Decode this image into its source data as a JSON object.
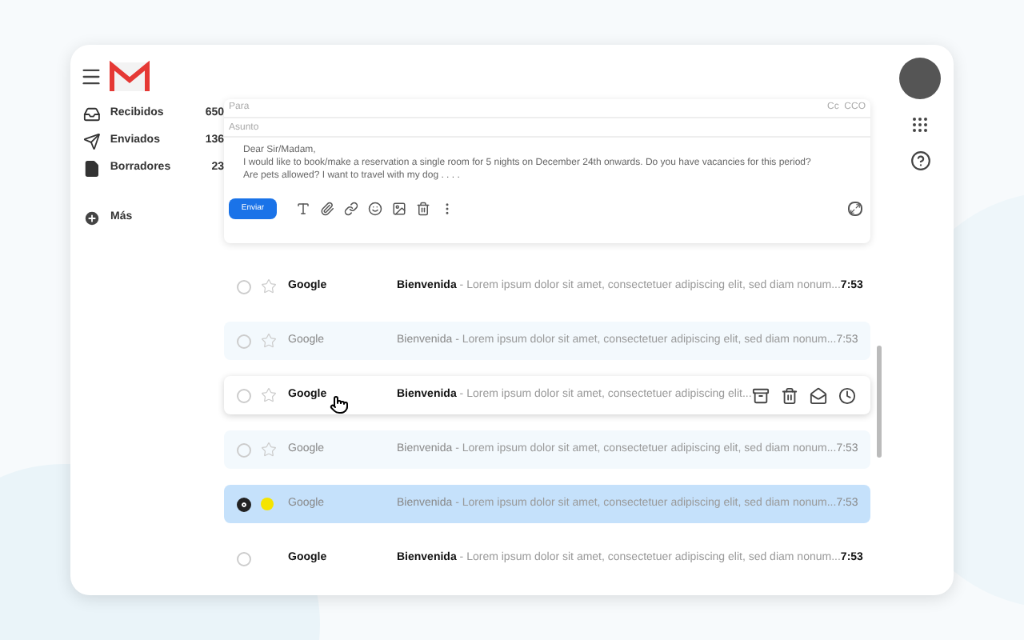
{
  "sidebar": {
    "items": [
      {
        "kind": "inbox",
        "label": "Recibidos",
        "count": "650"
      },
      {
        "kind": "sent",
        "label": "Enviados",
        "count": "136"
      },
      {
        "kind": "drafts",
        "label": "Borradores",
        "count": "23"
      }
    ],
    "more": "Más"
  },
  "compose": {
    "to_placeholder": "Para",
    "cc": "Cc  CCO",
    "subject_placeholder": "Asunto",
    "body": [
      "Dear Sir/Madam,",
      "I would like to book/make a reservation a single room for 5 nights on December 24th onwards. Do you have vacancies for this period?",
      "Are pets allowed? I want to travel with my dog . . . ."
    ],
    "send": "Enviar"
  },
  "rows": [
    {
      "sender": "Google",
      "subject": "Bienvenida",
      "snippet": " - Lorem ipsum dolor sit amet, consectetuer adipiscing elit, sed diam nonum...",
      "time": "7:53",
      "read": false,
      "selected": false,
      "starred": false,
      "hovered": false
    },
    {
      "sender": "Google",
      "subject": "Bienvenida",
      "snippet": " - Lorem ipsum dolor sit amet, consectetuer adipiscing elit, sed diam nonum...",
      "time": "7:53",
      "read": true,
      "selected": false,
      "starred": false,
      "hovered": false
    },
    {
      "sender": "Google",
      "subject": "Bienvenida",
      "snippet": " - Lorem ipsum dolor sit amet, consectetuer adipiscing elit...",
      "read": false,
      "selected": false,
      "starred": false,
      "hovered": true
    },
    {
      "sender": "Google",
      "subject": "Bienvenida",
      "snippet": " - Lorem ipsum dolor sit amet, consectetuer adipiscing elit, sed diam nonum...",
      "time": "7:53",
      "read": true,
      "selected": false,
      "starred": false,
      "hovered": false
    },
    {
      "sender": "Google",
      "subject": "Bienvenida",
      "snippet": " - Lorem ipsum dolor sit amet, consectetuer adipiscing elit, sed diam nonum...",
      "time": "7:53",
      "read": true,
      "selected": true,
      "starred": true,
      "hovered": false
    },
    {
      "sender": "Google",
      "subject": "Bienvenida",
      "snippet": " - Lorem ipsum dolor sit amet, consectetuer adipiscing elit, sed diam nonum...",
      "time": "7:53",
      "read": false,
      "selected": false,
      "hovered": false
    }
  ]
}
